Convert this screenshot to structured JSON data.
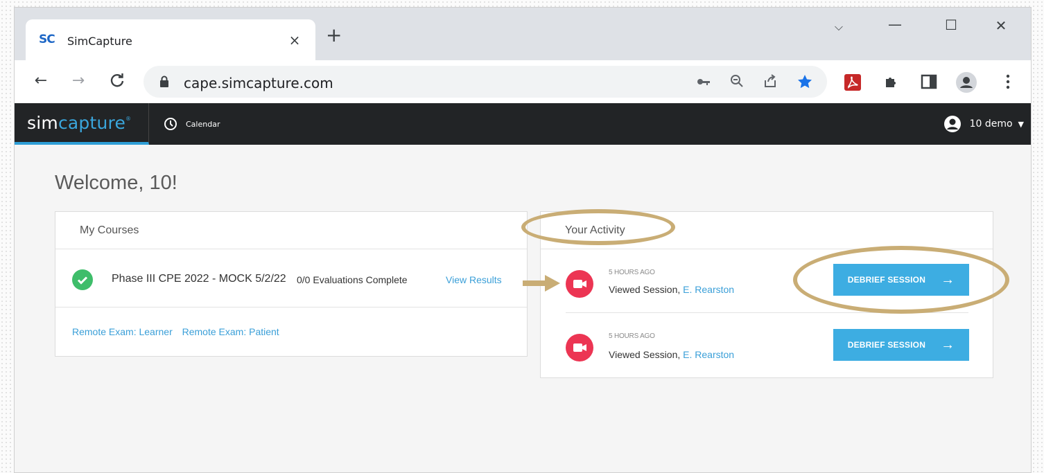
{
  "browser": {
    "tab_favicon": "SC",
    "tab_title": "SimCapture",
    "tab_close": "×",
    "new_tab": "+",
    "window_controls": {
      "tab_search": "⌵",
      "minimize": "—",
      "maximize": "☐",
      "close": "✕"
    },
    "url": "cape.simcapture.com",
    "nav": {
      "back": "←",
      "forward": "→",
      "reload": "C"
    },
    "omnibox_icons": [
      "key-icon",
      "zoom-icon",
      "share-icon",
      "bookmark-star-icon"
    ],
    "extension_icons": [
      "pdf-extension-icon",
      "puzzle-icon",
      "side-panel-icon",
      "profile-icon",
      "kebab-menu-icon"
    ],
    "colors": {
      "star": "#1a73e8",
      "pdf": "#c62828"
    }
  },
  "app": {
    "brand_sim": "sim",
    "brand_capture": "capture",
    "brand_mark": "®",
    "nav": {
      "calendar_label": "Calendar"
    },
    "user": {
      "name": "10 demo"
    },
    "colors": {
      "bar": "#222426",
      "accent": "#2e9ed6"
    }
  },
  "page": {
    "welcome": "Welcome, 10!",
    "courses": {
      "title": "My Courses",
      "items": [
        {
          "name": "Phase III CPE 2022 - MOCK 5/2/22",
          "evaluations": "0/0 Evaluations Complete",
          "link": "View Results"
        }
      ],
      "links": [
        "Remote Exam: Learner",
        "Remote Exam: Patient"
      ]
    },
    "activity": {
      "title": "Your Activity",
      "items": [
        {
          "time": "5 HOURS AGO",
          "action": "Viewed Session, ",
          "person": "E. Rearston",
          "button": "DEBRIEF SESSION"
        },
        {
          "time": "5 HOURS AGO",
          "action": "Viewed Session, ",
          "person": "E. Rearston",
          "button": "DEBRIEF SESSION"
        }
      ]
    }
  },
  "annotations": {
    "color": "#c9ad75"
  }
}
